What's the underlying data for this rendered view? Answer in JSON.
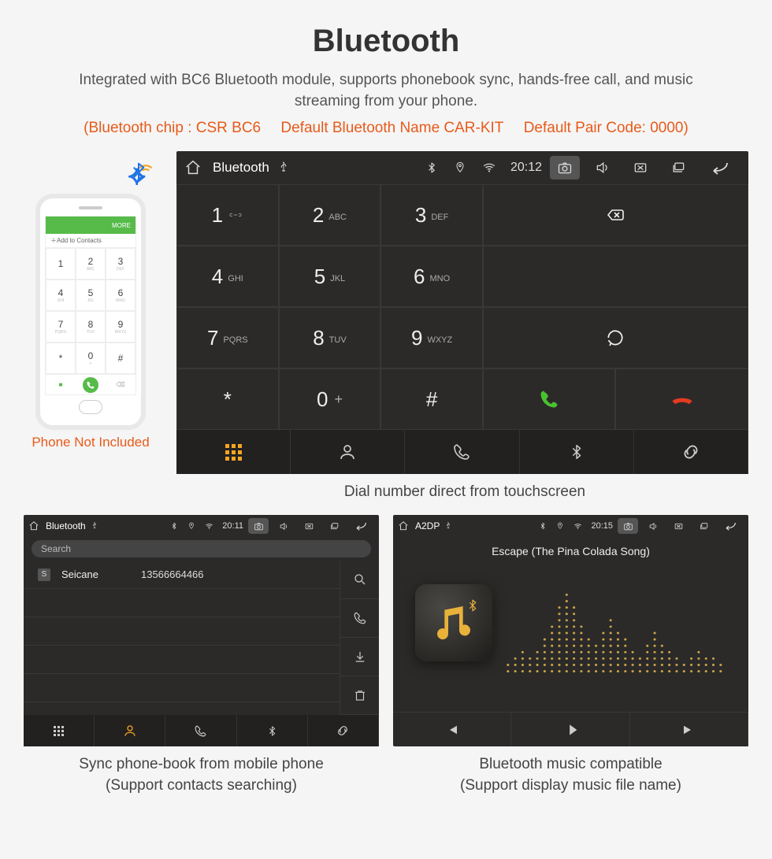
{
  "page": {
    "title": "Bluetooth",
    "subtitle": "Integrated with BC6 Bluetooth module, supports phonebook sync, hands-free call, and music streaming from your phone.",
    "spec_chip": "(Bluetooth chip : CSR BC6",
    "spec_name": "Default Bluetooth Name CAR-KIT",
    "spec_code": "Default Pair Code: 0000)"
  },
  "phone": {
    "top_more": "MORE",
    "add_contacts": "Add to Contacts",
    "not_included": "Phone Not Included",
    "keys": [
      {
        "d": "1",
        "s": ""
      },
      {
        "d": "2",
        "s": "ABC"
      },
      {
        "d": "3",
        "s": "DEF"
      },
      {
        "d": "4",
        "s": "GHI"
      },
      {
        "d": "5",
        "s": "JKL"
      },
      {
        "d": "6",
        "s": "MNO"
      },
      {
        "d": "7",
        "s": "PQRS"
      },
      {
        "d": "8",
        "s": "TUV"
      },
      {
        "d": "9",
        "s": "WXYZ"
      },
      {
        "d": "*",
        "s": ""
      },
      {
        "d": "0",
        "s": "+"
      },
      {
        "d": "#",
        "s": ""
      }
    ]
  },
  "hu_main": {
    "title": "Bluetooth",
    "time": "20:12",
    "caption": "Dial number direct from touchscreen",
    "keys": [
      {
        "d": "1",
        "s": "∞"
      },
      {
        "d": "2",
        "s": "ABC"
      },
      {
        "d": "3",
        "s": "DEF"
      },
      {
        "d": "4",
        "s": "GHI"
      },
      {
        "d": "5",
        "s": "JKL"
      },
      {
        "d": "6",
        "s": "MNO"
      },
      {
        "d": "7",
        "s": "PQRS"
      },
      {
        "d": "8",
        "s": "TUV"
      },
      {
        "d": "9",
        "s": "WXYZ"
      },
      {
        "d": "*",
        "s": ""
      },
      {
        "d": "0",
        "s": "+",
        "inline": true
      },
      {
        "d": "#",
        "s": ""
      }
    ]
  },
  "hu_contacts": {
    "title": "Bluetooth",
    "time": "20:11",
    "search": "Search",
    "row": {
      "letter": "S",
      "name": "Seicane",
      "number": "13566664466"
    },
    "caption1": "Sync phone-book from mobile phone",
    "caption2": "(Support contacts searching)"
  },
  "hu_music": {
    "title": "A2DP",
    "time": "20:15",
    "song": "Escape (The Pina Colada Song)",
    "caption1": "Bluetooth music compatible",
    "caption2": "(Support display music file name)"
  }
}
